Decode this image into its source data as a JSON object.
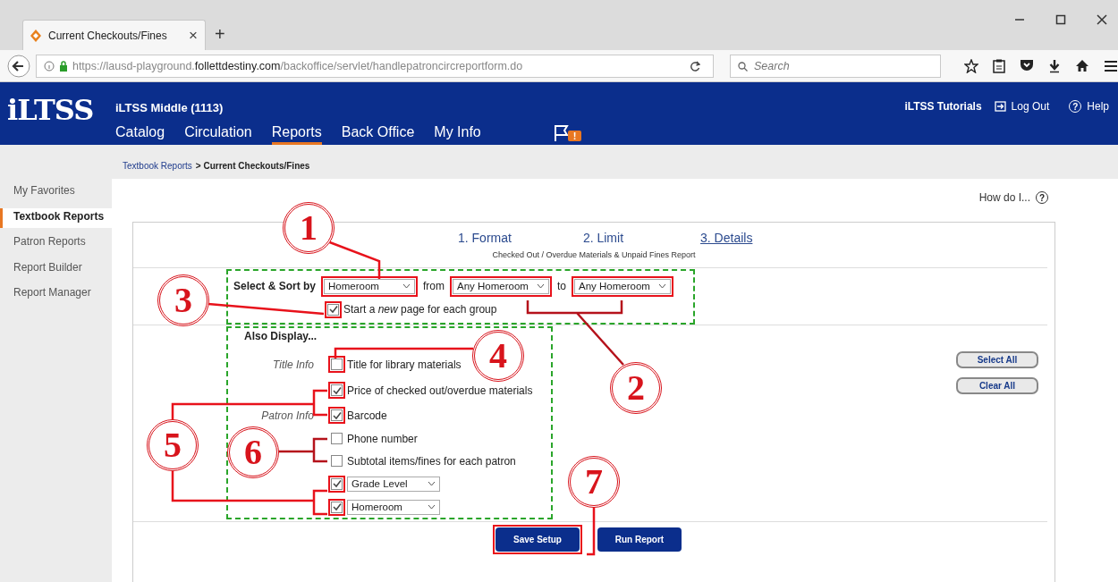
{
  "browser": {
    "tab": {
      "title": "Current Checkouts/Fines",
      "close": "×"
    },
    "new_tab": "+",
    "url": "https://lausd-playground.**follettdestiny.com**/backoffice/servlet/handlepatroncircreportform.do",
    "search": {
      "placeholder": "Search"
    }
  },
  "header": {
    "logo": "iLTSS",
    "site": "iLTSS Middle (1113)",
    "nav": [
      {
        "label": "Catalog",
        "selected": false
      },
      {
        "label": "Circulation",
        "selected": false
      },
      {
        "label": "Reports",
        "selected": true
      },
      {
        "label": "Back Office",
        "selected": false
      },
      {
        "label": "My Info",
        "selected": false
      }
    ],
    "alert_badge": "!",
    "tutorials": "iLTSS Tutorials",
    "logout": "Log Out",
    "help_glyph": "?",
    "help": "Help"
  },
  "breadcrumb": {
    "parent": "Textbook Reports",
    "current": "> Current Checkouts/Fines"
  },
  "sidebar": [
    {
      "label": "My Favorites",
      "selected": false
    },
    {
      "label": "Textbook Reports",
      "selected": true
    },
    {
      "label": "Patron Reports",
      "selected": false
    },
    {
      "label": "Report Builder",
      "selected": false
    },
    {
      "label": "Report Manager",
      "selected": false
    }
  ],
  "how_do_i": {
    "label": "How do I...",
    "glyph": "?"
  },
  "steps": [
    {
      "label": "1. Format",
      "selected": false
    },
    {
      "label": "2. Limit",
      "selected": false
    },
    {
      "label": "3. Details",
      "selected": true
    }
  ],
  "report_title": "Checked Out / Overdue Materials & Unpaid Fines Report",
  "select_sort": {
    "outlined": true,
    "label": "Select & Sort by",
    "sort_by": {
      "value": "Homeroom",
      "marked": true
    },
    "from_label": "from",
    "from": {
      "value": "Any Homeroom",
      "marked": true
    },
    "to_label": "to",
    "to": {
      "value": "Any Homeroom",
      "marked": true
    },
    "new_page": {
      "label": "Start a *new* page for each group",
      "checked": true,
      "marked": true
    }
  },
  "also_display": {
    "outlined": true,
    "title": "Also Display...",
    "rows": [
      {
        "kind": "checkbox",
        "group": "Title Info",
        "label": "Title for library materials",
        "checked": false,
        "marked": true
      },
      {
        "kind": "checkbox",
        "label": "Price of checked out/overdue materials",
        "checked": true,
        "marked": true
      },
      {
        "kind": "checkbox",
        "group": "Patron Info",
        "label": "Barcode",
        "checked": true,
        "marked": true
      },
      {
        "kind": "checkbox",
        "label": "Phone number",
        "checked": false,
        "marked": false
      },
      {
        "kind": "checkbox",
        "label": "Subtotal items/fines for each patron",
        "checked": false,
        "marked": false
      },
      {
        "kind": "select",
        "value": "Grade Level",
        "checked": true,
        "marked": true
      },
      {
        "kind": "select",
        "value": "Homeroom",
        "checked": true,
        "marked": true
      }
    ]
  },
  "side_buttons": [
    "Select All",
    "Clear All"
  ],
  "actions": [
    {
      "label": "Save Setup",
      "marked": true
    },
    {
      "label": "Run Report",
      "marked": false
    }
  ],
  "callouts": [
    "1",
    "2",
    "3",
    "4",
    "5",
    "6",
    "7"
  ]
}
